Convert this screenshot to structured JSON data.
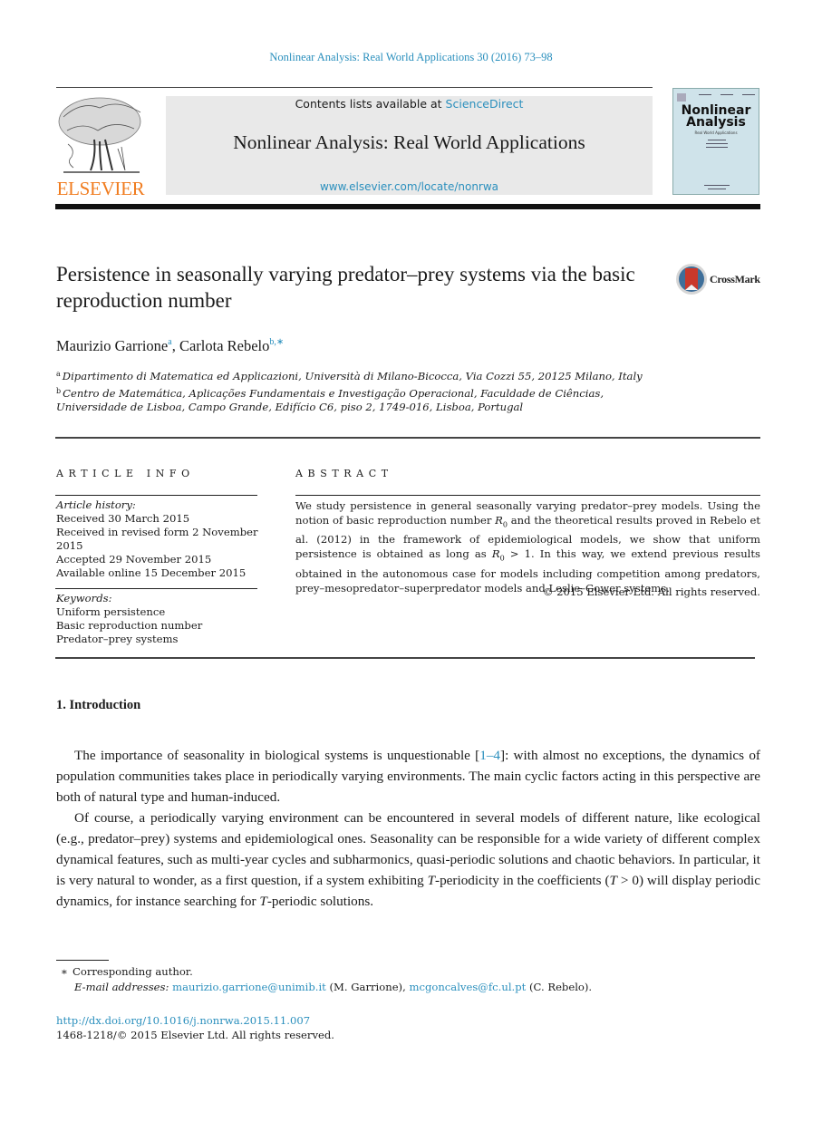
{
  "header": {
    "journal_reference": "Nonlinear Analysis: Real World Applications 30 (2016) 73–98",
    "contents_prefix": "Contents lists available at ",
    "contents_link": "ScienceDirect",
    "journal_title": "Nonlinear Analysis: Real World Applications",
    "journal_url": "www.elsevier.com/locate/nonrwa",
    "publisher_logo_text": "ELSEVIER",
    "cover_title_line1": "Nonlinear",
    "cover_title_line2": "Analysis",
    "cover_subtitle": "Real World Applications"
  },
  "article": {
    "title": "Persistence in seasonally varying predator–prey systems via the basic reproduction number",
    "crossmark_label": "CrossMark",
    "authors": [
      {
        "name": "Maurizio Garrione",
        "marks": "a"
      },
      {
        "name": "Carlota Rebelo",
        "marks": "b,∗"
      }
    ],
    "author_separator": ", ",
    "affiliations": [
      {
        "mark": "a",
        "text": "Dipartimento di Matematica ed Applicazioni, Università di Milano-Bicocca, Via Cozzi 55, 20125 Milano, Italy"
      },
      {
        "mark": "b",
        "text": "Centro de Matemática, Aplicações Fundamentais e Investigação Operacional, Faculdade de Ciências, Universidade de Lisboa, Campo Grande, Edifício C6, piso 2, 1749-016, Lisboa, Portugal"
      }
    ]
  },
  "article_info": {
    "heading": "ARTICLE INFO",
    "history_label": "Article history:",
    "history": [
      "Received 30 March 2015",
      "Received in revised form 2 November 2015",
      "Accepted 29 November 2015",
      "Available online 15 December 2015"
    ],
    "keywords_label": "Keywords:",
    "keywords": [
      "Uniform persistence",
      "Basic reproduction number",
      "Predator–prey systems"
    ]
  },
  "abstract": {
    "heading": "ABSTRACT",
    "text_parts": [
      "We study persistence in general seasonally varying predator–prey models. Using the notion of basic reproduction number ",
      " and the theoretical results proved in Rebelo et al. (2012) in the framework of epidemiological models, we show that uniform persistence is obtained as long as ",
      " > 1. In this way, we extend previous results obtained in the autonomous case for models including competition among predators, prey–mesopredator–superpredator models and Leslie–Gower systems."
    ],
    "symbol": "R",
    "symbol_sub": "0",
    "copyright": "© 2015 Elsevier Ltd. All rights reserved."
  },
  "body": {
    "section_heading": "1.  Introduction",
    "paragraph1": {
      "before_ref": "The importance of seasonality in biological systems is unquestionable [",
      "ref": "1–4",
      "after_ref": "]: with almost no exceptions, the dynamics of population communities takes place in periodically varying environments. The main cyclic factors acting in this perspective are both of natural type and human-induced."
    },
    "paragraph2": {
      "part1": "Of course, a periodically varying environment can be encountered in several models of different nature, like ecological (e.g., predator–prey) systems and epidemiological ones. Seasonality can be responsible for a wide variety of different complex dynamical features, such as multi-year cycles and subharmonics, quasi-periodic solutions and chaotic behaviors. In particular, it is very natural to wonder, as a first question, if a system exhibiting ",
      "T1": "T",
      "part2": "-periodicity in the coefficients (",
      "T2": "T",
      "part3": " > 0) will display periodic dynamics, for instance searching for ",
      "T3": "T",
      "part4": "-periodic solutions."
    }
  },
  "footnotes": {
    "star": "∗",
    "corresponding": "Corresponding author.",
    "email_label": "E-mail addresses:",
    "email1": "maurizio.garrione@unimib.it",
    "email1_owner": " (M. Garrione), ",
    "email2": "mcgoncalves@fc.ul.pt",
    "email2_owner": " (C. Rebelo).",
    "doi": "http://dx.doi.org/10.1016/j.nonrwa.2015.11.007",
    "issn_copyright": "1468-1218/© 2015 Elsevier Ltd. All rights reserved."
  },
  "colors": {
    "link": "#2a8fbd",
    "elsevier_orange": "#f07c1f",
    "header_box": "#e9e9e9"
  }
}
